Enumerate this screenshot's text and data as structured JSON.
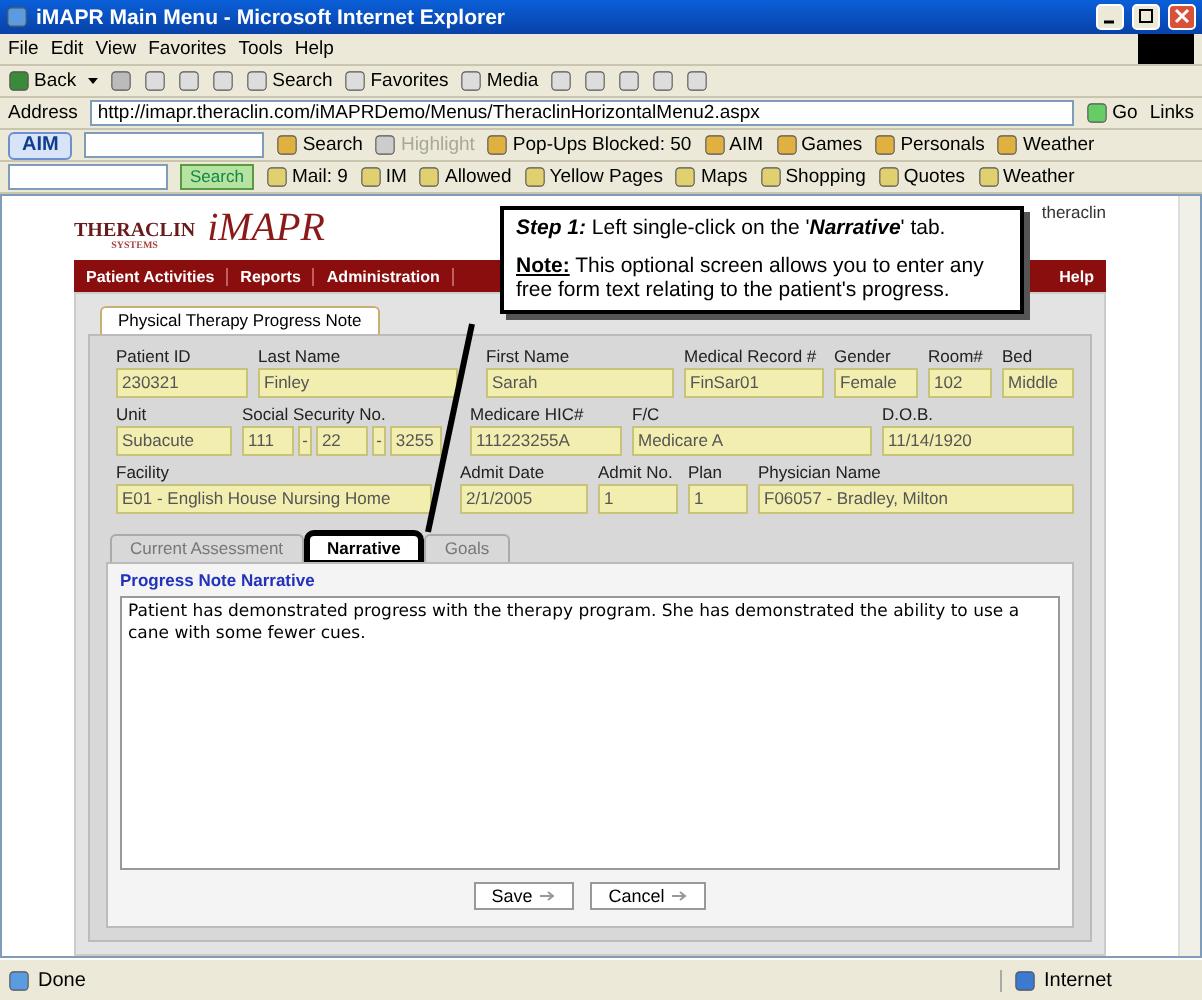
{
  "window": {
    "title": "iMAPR Main Menu - Microsoft Internet Explorer"
  },
  "menu": [
    "File",
    "Edit",
    "View",
    "Favorites",
    "Tools",
    "Help"
  ],
  "toolbar": [
    {
      "label": "Back",
      "kind": "back"
    },
    {
      "label": "Search",
      "kind": "button"
    },
    {
      "label": "Favorites",
      "kind": "button"
    },
    {
      "label": "Media",
      "kind": "button"
    }
  ],
  "address": {
    "label": "Address",
    "value": "http://imapr.theraclin.com/iMAPRDemo/Menus/TheraclinHorizontalMenu2.aspx",
    "go": "Go",
    "links": "Links"
  },
  "aim_bar": {
    "brand": "AIM",
    "items": [
      {
        "label": "Search",
        "disabled": false
      },
      {
        "label": "Highlight",
        "disabled": true
      },
      {
        "label": "Pop-Ups Blocked: 50",
        "disabled": false
      },
      {
        "label": "AIM",
        "disabled": false
      },
      {
        "label": "Games",
        "disabled": false
      },
      {
        "label": "Personals",
        "disabled": false
      },
      {
        "label": "Weather",
        "disabled": false
      }
    ]
  },
  "search_bar": {
    "button": "Search",
    "items": [
      "Mail: 9",
      "IM",
      "Allowed",
      "Yellow Pages",
      "Maps",
      "Shopping",
      "Quotes",
      "Weather"
    ]
  },
  "page": {
    "logo_brand": "THERACLIN",
    "logo_sub": "SYSTEMS",
    "logo_product": "iMAPR",
    "header_user": "theraclin",
    "nav": [
      "Patient Activities",
      "Reports",
      "Administration",
      "Help"
    ],
    "card_title": "Physical Therapy Progress Note",
    "field_rows": [
      [
        {
          "label": "Patient ID",
          "values": [
            "230321"
          ]
        },
        {
          "label": "Last Name",
          "values": [
            "Finley"
          ]
        },
        {
          "label": "First Name",
          "values": [
            "Sarah"
          ]
        },
        {
          "label": "Medical Record #",
          "values": [
            "FinSar01"
          ]
        },
        {
          "label": "Gender",
          "values": [
            "Female"
          ]
        },
        {
          "label": "Room#",
          "values": [
            "102"
          ]
        },
        {
          "label": "Bed",
          "values": [
            "Middle"
          ]
        }
      ],
      [
        {
          "label": "Unit",
          "values": [
            "Subacute"
          ]
        },
        {
          "label": "Social Security No.",
          "values": [
            "111",
            "22",
            "3255"
          ],
          "separator": "-"
        },
        {
          "label": "Medicare HIC#",
          "values": [
            "111223255A"
          ]
        },
        {
          "label": "F/C",
          "values": [
            "Medicare A"
          ]
        },
        {
          "label": "D.O.B.",
          "values": [
            "11/14/1920"
          ]
        }
      ],
      [
        {
          "label": "Facility",
          "values": [
            "E01 - English House Nursing Home"
          ]
        },
        {
          "label": "Admit Date",
          "values": [
            "2/1/2005"
          ]
        },
        {
          "label": "Admit No.",
          "values": [
            "1"
          ]
        },
        {
          "label": "Plan",
          "values": [
            "1"
          ]
        },
        {
          "label": "Physician Name",
          "values": [
            "F06057 - Bradley, Milton"
          ]
        }
      ]
    ],
    "tabs": [
      {
        "label": "Current Assessment",
        "selected": false,
        "highlighted": false
      },
      {
        "label": "Narrative",
        "selected": true,
        "highlighted": true
      },
      {
        "label": "Goals",
        "selected": false,
        "highlighted": false
      }
    ],
    "narrative_label": "Progress Note Narrative",
    "narrative_text": "Patient has demonstrated progress with the therapy program. She has demonstrated the ability to use a cane with some fewer cues.",
    "buttons": [
      "Save",
      "Cancel"
    ]
  },
  "callout": {
    "step": "**Step 1:** Left single-click on the '**Narrative**' tab.",
    "note": "**Note:** This optional screen allows you to enter any free form text relating to the patient's progress."
  },
  "status_bar": {
    "text": "Done",
    "zone": "Internet"
  }
}
